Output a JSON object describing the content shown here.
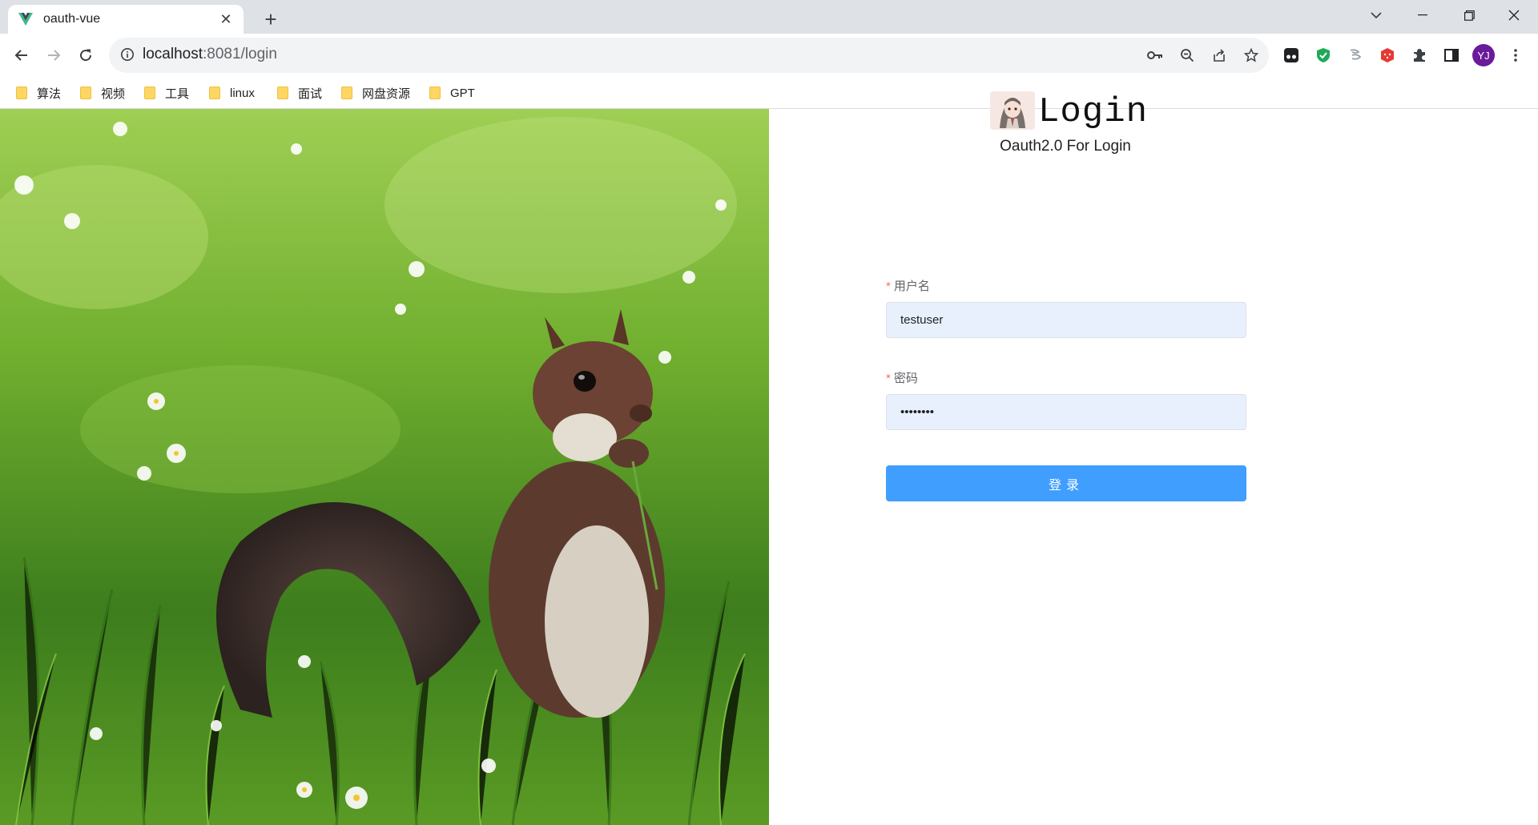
{
  "browser": {
    "tab_title": "oauth-vue",
    "new_tab_symbol": "+",
    "tab_close_symbol": "✕",
    "url_host": "localhost",
    "url_rest": ":8081/login",
    "avatar_initials": "YJ",
    "bookmarks": [
      "算法",
      "视频",
      "工具",
      "linux",
      "面试",
      "网盘资源",
      "GPT"
    ]
  },
  "login": {
    "title": "Login",
    "subtitle": "Oauth2.0 For Login",
    "username_label": "用户名",
    "username_value": "testuser",
    "password_label": "密码",
    "password_value": "••••••••",
    "required_mark": "*",
    "submit_label": "登录"
  },
  "colors": {
    "primary": "#409eff",
    "input_autofill_bg": "#e8f0fe",
    "required": "#f56c6c"
  },
  "icons": [
    "vue-logo-icon",
    "back-arrow-icon",
    "forward-arrow-icon",
    "reload-icon",
    "info-icon",
    "key-icon",
    "zoom-out-icon",
    "share-icon",
    "star-icon",
    "extension-icon",
    "shield-icon",
    "puzzle-icon",
    "side-panel-icon",
    "more-icon",
    "folder-icon"
  ]
}
